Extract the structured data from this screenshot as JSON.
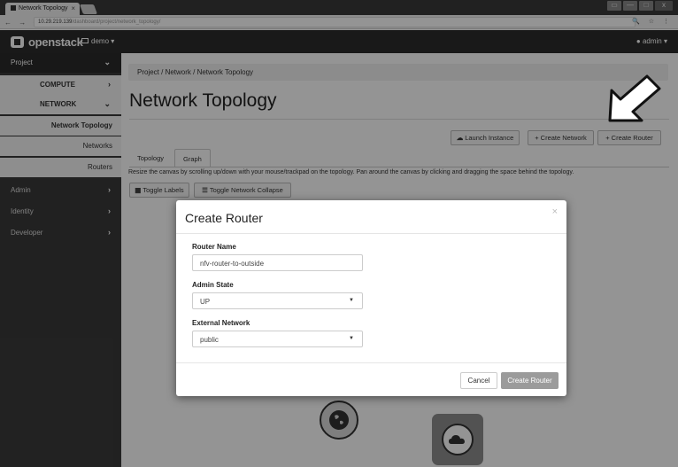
{
  "browser": {
    "tab_title": "Network Topology",
    "tab_close": "×",
    "url_host": "10.29.219.139",
    "url_path": "/dashboard/project/network_topology/",
    "nav_buttons": "← → C ⓘ",
    "addr_icons": "🔍 ☆ ⋮",
    "window_controls": [
      "▭",
      "—",
      "□",
      "x"
    ]
  },
  "header": {
    "logo_text": "openstack",
    "project_selector": "demo ▾",
    "user_menu": "admin ▾"
  },
  "sidebar": {
    "project": "Project",
    "compute": "COMPUTE",
    "network": "NETWORK",
    "network_topology": "Network Topology",
    "networks": "Networks",
    "routers": "Routers",
    "admin": "Admin",
    "identity": "Identity",
    "developer": "Developer"
  },
  "main": {
    "breadcrumb": "Project /  Network /  Network Topology",
    "title": "Network Topology",
    "launch_instance": "Launch Instance",
    "create_network": "+ Create Network",
    "create_router": "+ Create Router",
    "tab_topology": "Topology",
    "tab_graph": "Graph",
    "help_text": "Resize the canvas by scrolling up/down with your mouse/trackpad on the topology. Pan around the canvas by clicking and dragging the space behind the topology.",
    "toggle_labels": "Toggle Labels",
    "toggle_collapse": "Toggle Network Collapse"
  },
  "modal": {
    "title": "Create Router",
    "close": "×",
    "router_name_label": "Router Name",
    "router_name_value": "nfv-router-to-outside",
    "admin_state_label": "Admin State",
    "admin_state_value": "UP",
    "external_network_label": "External Network",
    "external_network_value": "public",
    "cancel": "Cancel",
    "create": "Create Router"
  }
}
